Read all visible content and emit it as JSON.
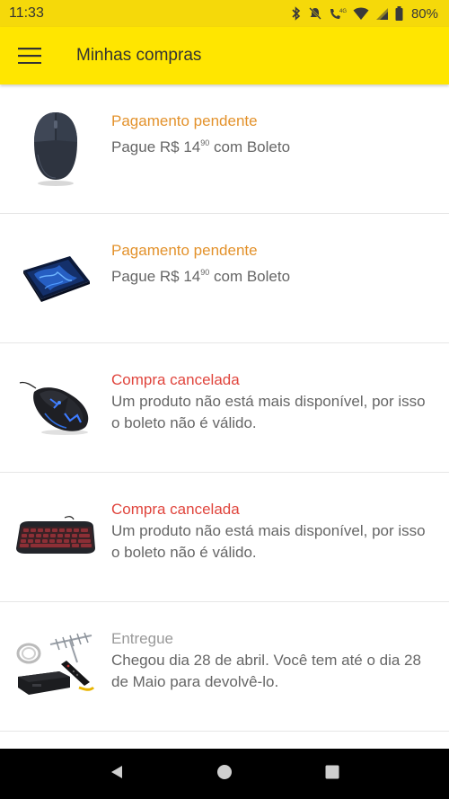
{
  "status_bar": {
    "time": "11:33",
    "network": "4G",
    "battery": "80%",
    "icons": [
      "bluetooth-icon",
      "mute-icon",
      "call-icon",
      "wifi-icon",
      "signal-icon",
      "battery-icon"
    ]
  },
  "app_bar": {
    "title": "Minhas compras",
    "menu_icon": "hamburger-menu-icon",
    "background": "#ffe600"
  },
  "purchases": [
    {
      "product": "mouse",
      "status": "Pagamento pendente",
      "status_color": "#e3922c",
      "desc_prefix": "Pague R$ 14",
      "desc_cents": "90",
      "desc_suffix": " com Boleto"
    },
    {
      "product": "mousepad",
      "status": "Pagamento pendente",
      "status_color": "#e3922c",
      "desc_prefix": "Pague R$ 14",
      "desc_cents": "90",
      "desc_suffix": " com Boleto"
    },
    {
      "product": "gaming-mouse",
      "status": "Compra cancelada",
      "status_color": "#e0453d",
      "description": "Um produto não está mais disponível, por isso o boleto não é válido."
    },
    {
      "product": "keyboard",
      "status": "Compra cancelada",
      "status_color": "#e0453d",
      "description": "Um produto não está mais disponível, por isso o boleto não é válido."
    },
    {
      "product": "tv-antenna-kit",
      "status": "Entregue",
      "status_color": "#999999",
      "description": "Chegou dia 28 de abril. Você tem até o dia 28 de Maio para devolvê-lo."
    }
  ],
  "nav_bar": {
    "icons": [
      "back-icon",
      "home-icon",
      "recents-icon"
    ]
  }
}
